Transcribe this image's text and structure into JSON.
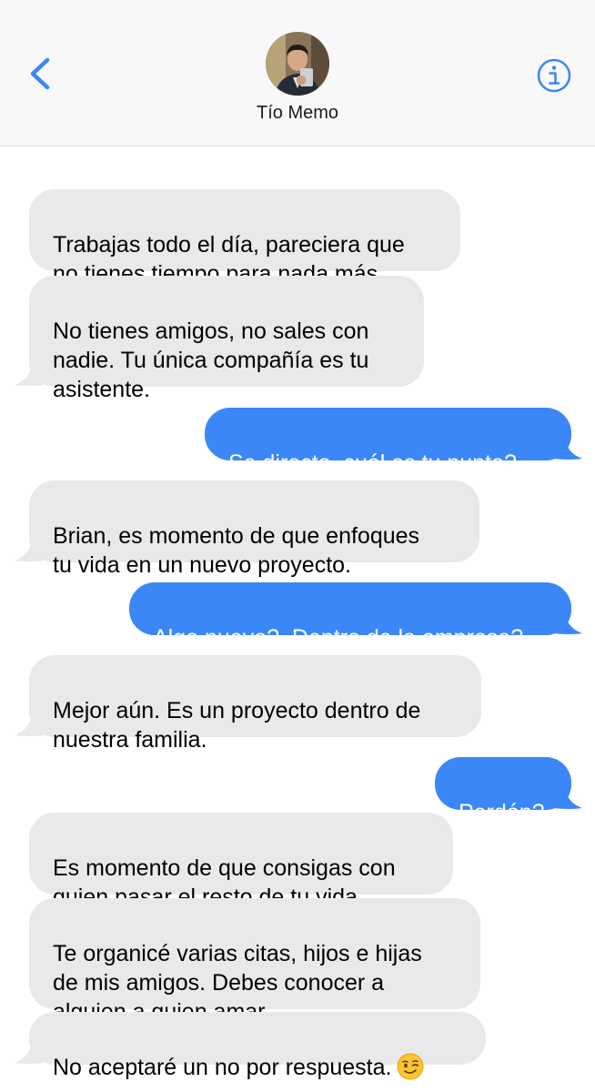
{
  "header": {
    "contact_name": "Tío Memo",
    "back_icon": "chevron-left-icon",
    "info_icon": "info-circle-icon",
    "accent_color": "#3b87f7"
  },
  "messages": [
    {
      "from": "contact",
      "text": "Trabajas todo el día, pareciera que\nno tienes tiempo para nada más."
    },
    {
      "from": "contact",
      "text": "No tienes amigos, no sales con\nnadie. Tu única compañía es tu\nasistente."
    },
    {
      "from": "me",
      "text": "Se directo, cuál es tu punto?"
    },
    {
      "from": "contact",
      "text": "Brian, es momento de que enfoques\ntu vida en un nuevo proyecto."
    },
    {
      "from": "me",
      "text": "Algo nuevo?, Dentro de la empresa?"
    },
    {
      "from": "contact",
      "text": "Mejor aún. Es un proyecto dentro de\nnuestra familia."
    },
    {
      "from": "me",
      "text": "Perdón?"
    },
    {
      "from": "contact",
      "text": "Es momento de que consigas con\nquien pasar el resto de tu vida."
    },
    {
      "from": "contact",
      "text": "Te organicé varias citas, hijos e hijas\nde mis amigos. Debes conocer a\nalguien a quien amar."
    },
    {
      "from": "contact",
      "text": "No aceptaré un no por respuesta.",
      "emoji": "winking-face-emoji"
    }
  ],
  "colors": {
    "received_bubble": "#e9e9eb",
    "sent_bubble": "#3b87f7",
    "header_bg": "#f8f8f8"
  }
}
